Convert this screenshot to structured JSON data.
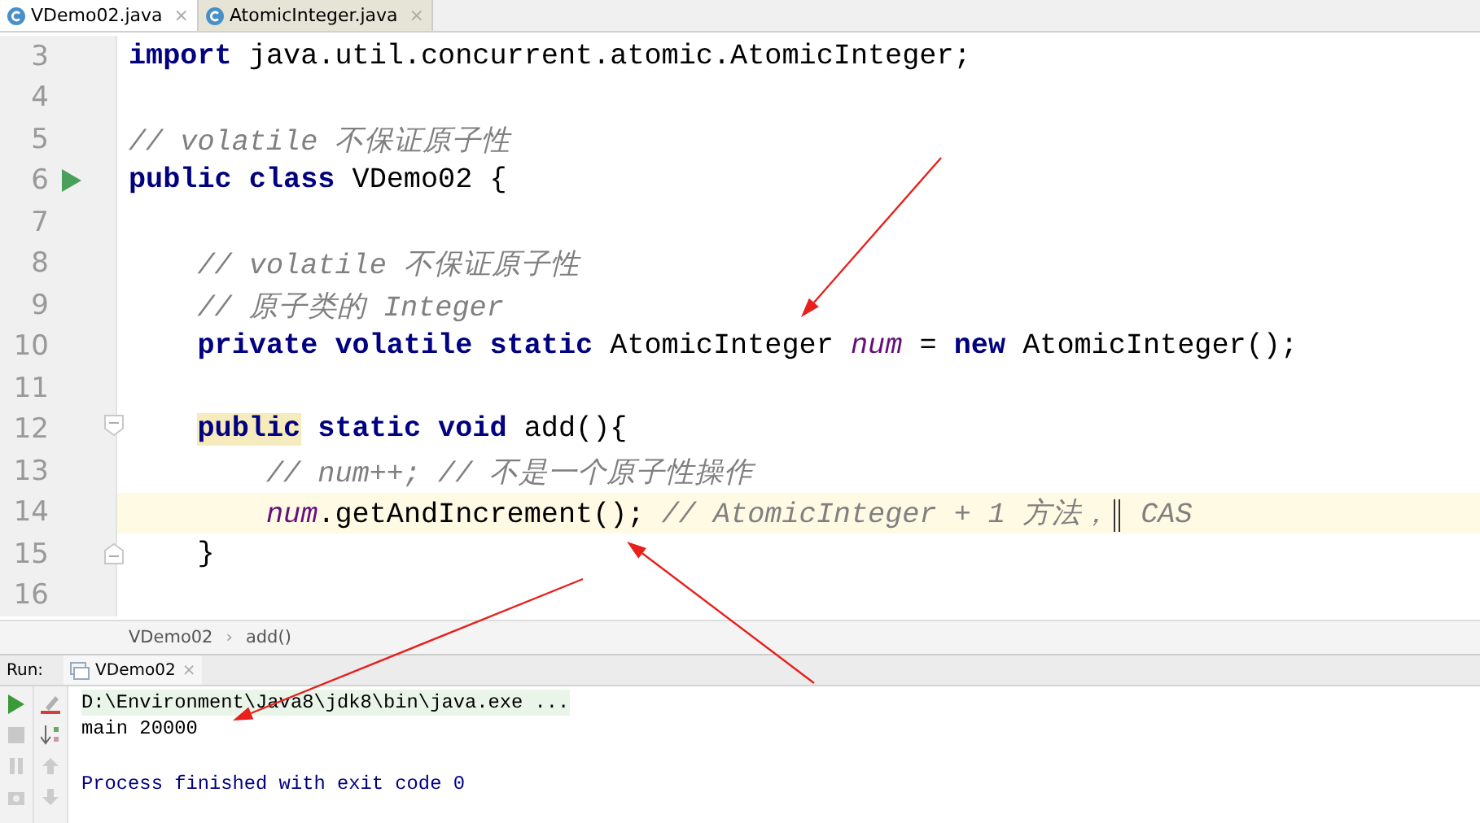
{
  "tabs": [
    {
      "label": "VDemo02.java",
      "selected": true,
      "close": "×"
    },
    {
      "label": "AtomicInteger.java",
      "selected": false,
      "close": "×"
    }
  ],
  "editor": {
    "lines": [
      {
        "number": "3",
        "current": false,
        "kind": "plain",
        "tokens": [
          {
            "kind": "keyword",
            "text": "import"
          },
          {
            "kind": "plain",
            "text": " java.util.concurrent.atomic.AtomicInteger;"
          }
        ]
      },
      {
        "number": "4",
        "current": false,
        "kind": "plain"
      },
      {
        "number": "5",
        "current": false,
        "kind": "plain",
        "tokens": [
          {
            "kind": "comment",
            "text": "// volatile 不保证原子性"
          }
        ]
      },
      {
        "number": "6",
        "current": false,
        "kind": "run",
        "tokens": [
          {
            "kind": "keyword",
            "text": "public class"
          },
          {
            "kind": "plain",
            "text": " VDemo02 {"
          }
        ]
      },
      {
        "number": "7",
        "current": false,
        "kind": "plain"
      },
      {
        "number": "8",
        "current": false,
        "kind": "plain",
        "tokens": [
          {
            "kind": "comment",
            "text": "    // volatile 不保证原子性"
          }
        ]
      },
      {
        "number": "9",
        "current": false,
        "kind": "plain",
        "tokens": [
          {
            "kind": "comment",
            "text": "    // 原子类的 Integer"
          }
        ]
      },
      {
        "number": "10",
        "current": false,
        "kind": "plain",
        "tokens": [
          {
            "kind": "keyword",
            "text": "    private volatile static"
          },
          {
            "kind": "plain",
            "text": " AtomicInteger "
          },
          {
            "kind": "field",
            "text": "num"
          },
          {
            "kind": "plain",
            "text": " = "
          },
          {
            "kind": "keyword",
            "text": "new"
          },
          {
            "kind": "plain",
            "text": " AtomicInteger();"
          }
        ]
      },
      {
        "number": "11",
        "current": false,
        "kind": "plain"
      },
      {
        "number": "12",
        "current": false,
        "kind": "fold-start",
        "tokens": [
          {
            "kind": "keyword",
            "text": "    public",
            "highlighted": true
          },
          {
            "kind": "keyword",
            "text": " static void"
          },
          {
            "kind": "plain",
            "text": " add(){"
          }
        ]
      },
      {
        "number": "13",
        "current": false,
        "kind": "plain",
        "tokens": [
          {
            "kind": "comment",
            "text": "        // num++; // 不是一个原子性操作"
          }
        ]
      },
      {
        "number": "14",
        "current": true,
        "kind": "plain",
        "tokens": [
          {
            "kind": "field",
            "text": "        num"
          },
          {
            "kind": "plain",
            "text": ".getAndIncrement(); "
          },
          {
            "kind": "comment",
            "text": "// AtomicInteger + 1 方法，"
          },
          {
            "kind": "caret"
          },
          {
            "kind": "comment",
            "text": " CAS"
          }
        ]
      },
      {
        "number": "15",
        "current": false,
        "kind": "fold-end",
        "tokens": [
          {
            "kind": "plain",
            "text": "    }"
          }
        ]
      },
      {
        "number": "16",
        "current": false,
        "kind": "plain"
      }
    ]
  },
  "breadcrumbs": {
    "items": [
      "VDemo02",
      "add()"
    ],
    "separator": "›"
  },
  "run_panel": {
    "label": "Run:",
    "tab": "VDemo02",
    "tab_close": "×",
    "console": [
      {
        "kind": "command",
        "text": "D:\\Environment\\Java8\\jdk8\\bin\\java.exe ..."
      },
      {
        "kind": "output",
        "text": "main 20000"
      },
      {
        "kind": "system",
        "text": "Process finished with exit code 0"
      }
    ]
  }
}
